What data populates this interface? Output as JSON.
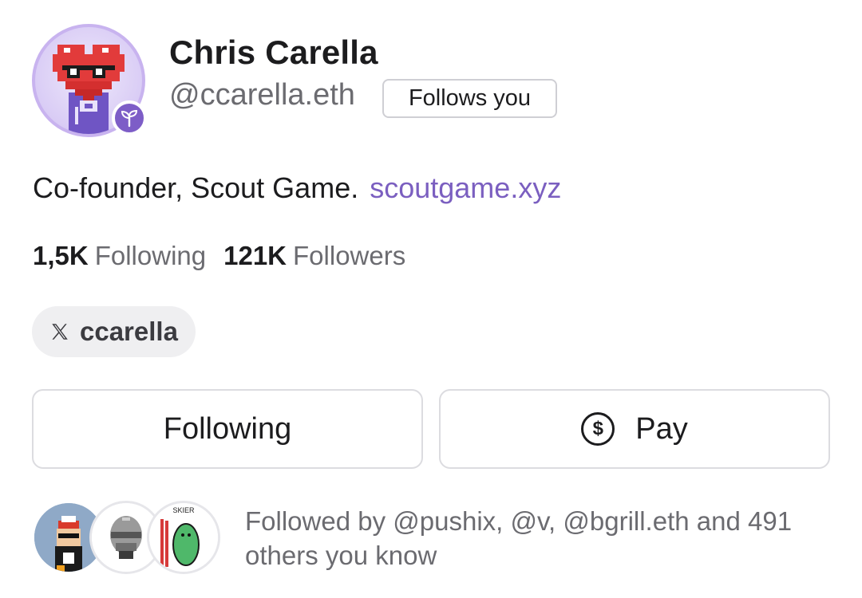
{
  "profile": {
    "name": "Chris Carella",
    "handle": "@ccarella.eth",
    "follows_you": "Follows you",
    "bio": "Co-founder, Scout Game.",
    "bio_link": "scoutgame.xyz",
    "avatar_icon": "pixel-heart-avatar",
    "badge_icon": "sprout-icon"
  },
  "stats": {
    "following_count": "1,5K",
    "following_label": "Following",
    "followers_count": "121K",
    "followers_label": "Followers"
  },
  "social": {
    "x_icon": "x-logo-icon",
    "x_label": "ccarella"
  },
  "actions": {
    "following_label": "Following",
    "pay_label": "Pay",
    "pay_icon": "dollar-circle-icon"
  },
  "mutuals": {
    "avatar3_caption": "SKIER",
    "text": "Followed by @pushix, @v, @bgrill.eth and 491 others you know"
  },
  "colors": {
    "accent": "#7b5fc0",
    "badge": "#7d5dc7",
    "muted_text": "#6b6b70"
  }
}
